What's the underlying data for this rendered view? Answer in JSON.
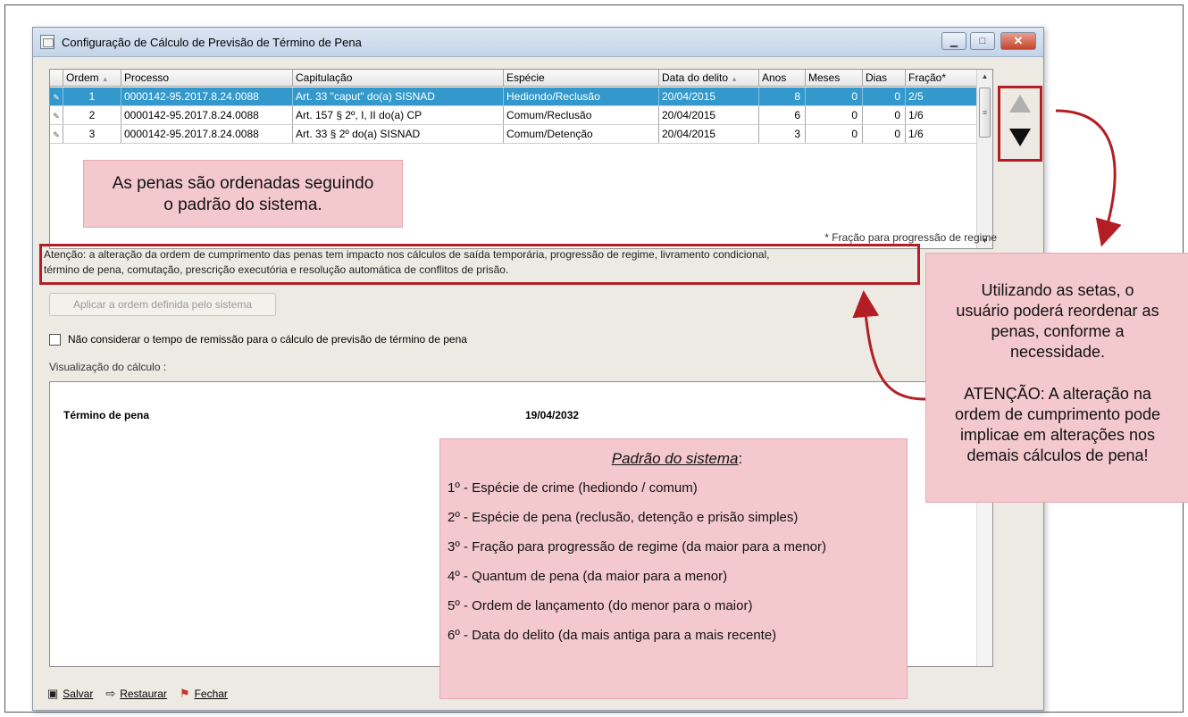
{
  "window": {
    "title": "Configuração de Cálculo de Previsão de Término de Pena",
    "minimize": "▁",
    "maximize": "□",
    "close": "✕"
  },
  "grid": {
    "columns": [
      "Ordem",
      "Processo",
      "Capitulação",
      "Espécie",
      "Data do delito",
      "Anos",
      "Meses",
      "Dias",
      "Fração*"
    ],
    "rows": [
      {
        "ordem": "1",
        "processo": "0000142-95.2017.8.24.0088",
        "capitulacao": "Art. 33 \"caput\" do(a) SISNAD",
        "especie": "Hediondo/Reclusão",
        "data": "20/04/2015",
        "anos": "8",
        "meses": "0",
        "dias": "0",
        "fracao": "2/5"
      },
      {
        "ordem": "2",
        "processo": "0000142-95.2017.8.24.0088",
        "capitulacao": "Art. 157 § 2º, I, II do(a) CP",
        "especie": "Comum/Reclusão",
        "data": "20/04/2015",
        "anos": "6",
        "meses": "0",
        "dias": "0",
        "fracao": "1/6"
      },
      {
        "ordem": "3",
        "processo": "0000142-95.2017.8.24.0088",
        "capitulacao": "Art. 33 § 2º do(a) SISNAD",
        "especie": "Comum/Detenção",
        "data": "20/04/2015",
        "anos": "3",
        "meses": "0",
        "dias": "0",
        "fracao": "1/6"
      }
    ],
    "selected_row": 0
  },
  "footnote": "* Fração para progressão de regime",
  "attention_line1": "Atenção: a alteração da ordem de cumprimento das penas tem impacto nos cálculos de saída temporária, progressão de regime, livramento condicional,",
  "attention_line2": "término de pena, comutação, prescrição executória e resolução automática de conflitos de prisão.",
  "apply_button": "Aplicar a ordem definida pelo sistema",
  "checkbox_label": "Não considerar o tempo de remissão para o cálculo de previsão de término de pena",
  "viz_label": "Visualização do cálculo :",
  "preview": {
    "label": "Término de pena",
    "value": "19/04/2032"
  },
  "toolbar": {
    "save": "Salvar",
    "restore": "Restaurar",
    "close": "Fechar"
  },
  "callouts": {
    "ordering_1": "As penas são ordenadas seguindo",
    "ordering_2": "o padrão do sistema.",
    "arrows_1": "Utilizando as setas, o",
    "arrows_2": "usuário poderá reordenar as",
    "arrows_3": "penas, conforme a",
    "arrows_4": "necessidade.",
    "warn_1": "ATENÇÃO: A alteração na",
    "warn_2": "ordem de cumprimento pode",
    "warn_3": "implicae em alterações nos",
    "warn_4": "demais cálculos de pena!",
    "standard_title": "Padrão do sistema",
    "standard_colon": ":",
    "standard_items": [
      "1º - Espécie de crime (hediondo / comum)",
      "2º - Espécie de pena (reclusão, detenção e prisão simples)",
      "3º - Fração para progressão de regime (da maior para a menor)",
      "4º - Quantum de pena (da maior para a menor)",
      "5º - Ordem de lançamento (do menor para o maior)",
      "6º - Data do delito (da mais antiga para a mais recente)"
    ]
  },
  "colors": {
    "selection": "#3399cc",
    "callout_bg": "#f4c9ce",
    "annotation_red": "#b31e24"
  },
  "icons": {
    "save": "floppy-icon",
    "restore": "restore-icon",
    "close": "flag-icon",
    "move_up": "arrow-up-icon",
    "move_down": "arrow-down-icon"
  }
}
